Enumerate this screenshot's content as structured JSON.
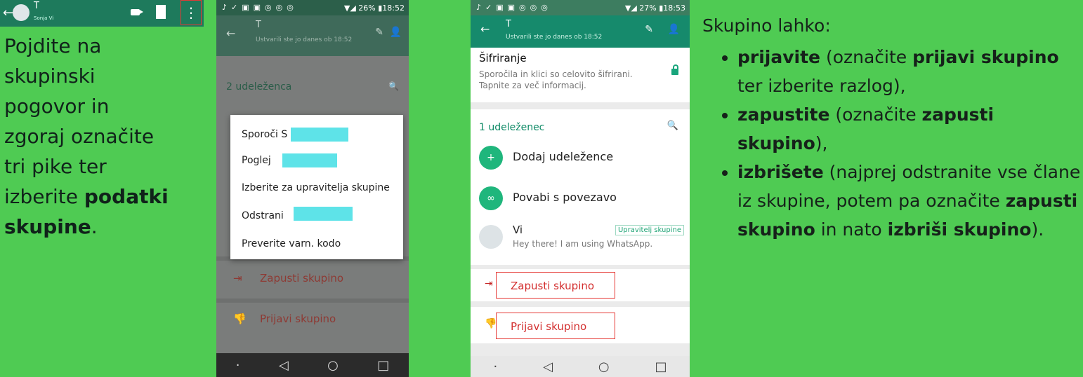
{
  "left_panel": {
    "topbar": {
      "contact_initial": "T",
      "contact_sub": "Sonja Vi"
    },
    "text_lines": [
      "Pojdite na",
      "skupinski",
      "pogovor in",
      "zgoraj označite",
      "tri pike ter",
      "izberite"
    ],
    "bold1": "podatki",
    "bold2": "skupine",
    "end": "."
  },
  "phone2": {
    "status_time": "18:52",
    "status_battery": "26%",
    "header_title": "T",
    "header_sub": "Ustvarili ste jo danes ob 18:52",
    "participants_count": "2 udeleženca",
    "dialog_items": [
      "Sporoči S",
      "Poglej",
      "Izberite za upravitelja skupine",
      "Odstrani",
      "Preverite varn. kodo"
    ],
    "leave": "Zapusti skupino",
    "report": "Prijavi skupino"
  },
  "phone3": {
    "status_time": "18:53",
    "status_battery": "27%",
    "header_title": "T",
    "header_sub": "Ustvarili ste jo danes ob 18:52",
    "encryption_title": "Šifriranje",
    "encryption_desc": "Sporočila in klici so celovito šifrirani. Tapnite za več informacij.",
    "participants_count": "1 udeleženec",
    "add_participants": "Dodaj udeležence",
    "invite_link": "Povabi s povezavo",
    "me_name": "Vi",
    "me_status": "Hey there! I am using WhatsApp.",
    "admin_badge": "Upravitelj skupine",
    "exit_group": "Zapusti skupino",
    "report_group": "Prijavi skupino"
  },
  "right_panel": {
    "title": "Skupino lahko:",
    "item1_bold": "prijavite",
    "item1_rest": " (označite ",
    "item1_bold2": "prijavi skupino",
    "item1_end": " ter izberite razlog),",
    "item2_bold": "zapustite",
    "item2_rest": " (označite ",
    "item2_bold2": "zapusti skupino",
    "item2_end": "),",
    "item3_bold": "izbrišete",
    "item3_rest": " (najprej odstranite vse člane iz skupine, potem pa označite ",
    "item3_bold2": "zapusti skupino",
    "item3_mid": " in nato ",
    "item3_bold3": "izbriši skupino",
    "item3_end": ")."
  }
}
